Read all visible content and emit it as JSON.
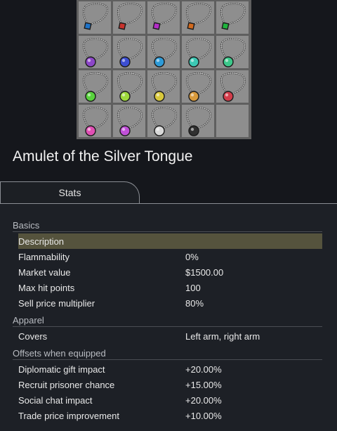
{
  "sheet": {
    "gem_colors": [
      "#1e73c8",
      "#c8322c",
      "#b42cc8",
      "#d26a1e",
      "#1eb43c",
      "#8c46c8",
      "#3c4ed2",
      "#2e9bd8",
      "#3cc8b4",
      "#3cc88a",
      "#58d23c",
      "#9ed83c",
      "#d8c83c",
      "#d89a3c",
      "#d23c4a",
      "#e050b4",
      "#c050d8",
      "#d8d8d8",
      "#303030"
    ],
    "empty_cell": true
  },
  "item": {
    "title": "Amulet of the Silver Tongue"
  },
  "tabs": [
    {
      "label": "Stats"
    }
  ],
  "stats": {
    "basics": {
      "header": "Basics",
      "rows": [
        {
          "label": "Description",
          "value": ""
        },
        {
          "label": "Flammability",
          "value": "0%"
        },
        {
          "label": "Market value",
          "value": "$1500.00"
        },
        {
          "label": "Max hit points",
          "value": "100"
        },
        {
          "label": "Sell price multiplier",
          "value": "80%"
        }
      ]
    },
    "apparel": {
      "header": "Apparel",
      "rows": [
        {
          "label": "Covers",
          "value": "Left arm, right arm"
        }
      ]
    },
    "offsets": {
      "header": "Offsets when equipped",
      "rows": [
        {
          "label": "Diplomatic gift impact",
          "value": "+20.00%"
        },
        {
          "label": "Recruit prisoner chance",
          "value": "+15.00%"
        },
        {
          "label": "Social chat impact",
          "value": "+20.00%"
        },
        {
          "label": "Trade price improvement",
          "value": "+10.00%"
        }
      ]
    }
  }
}
